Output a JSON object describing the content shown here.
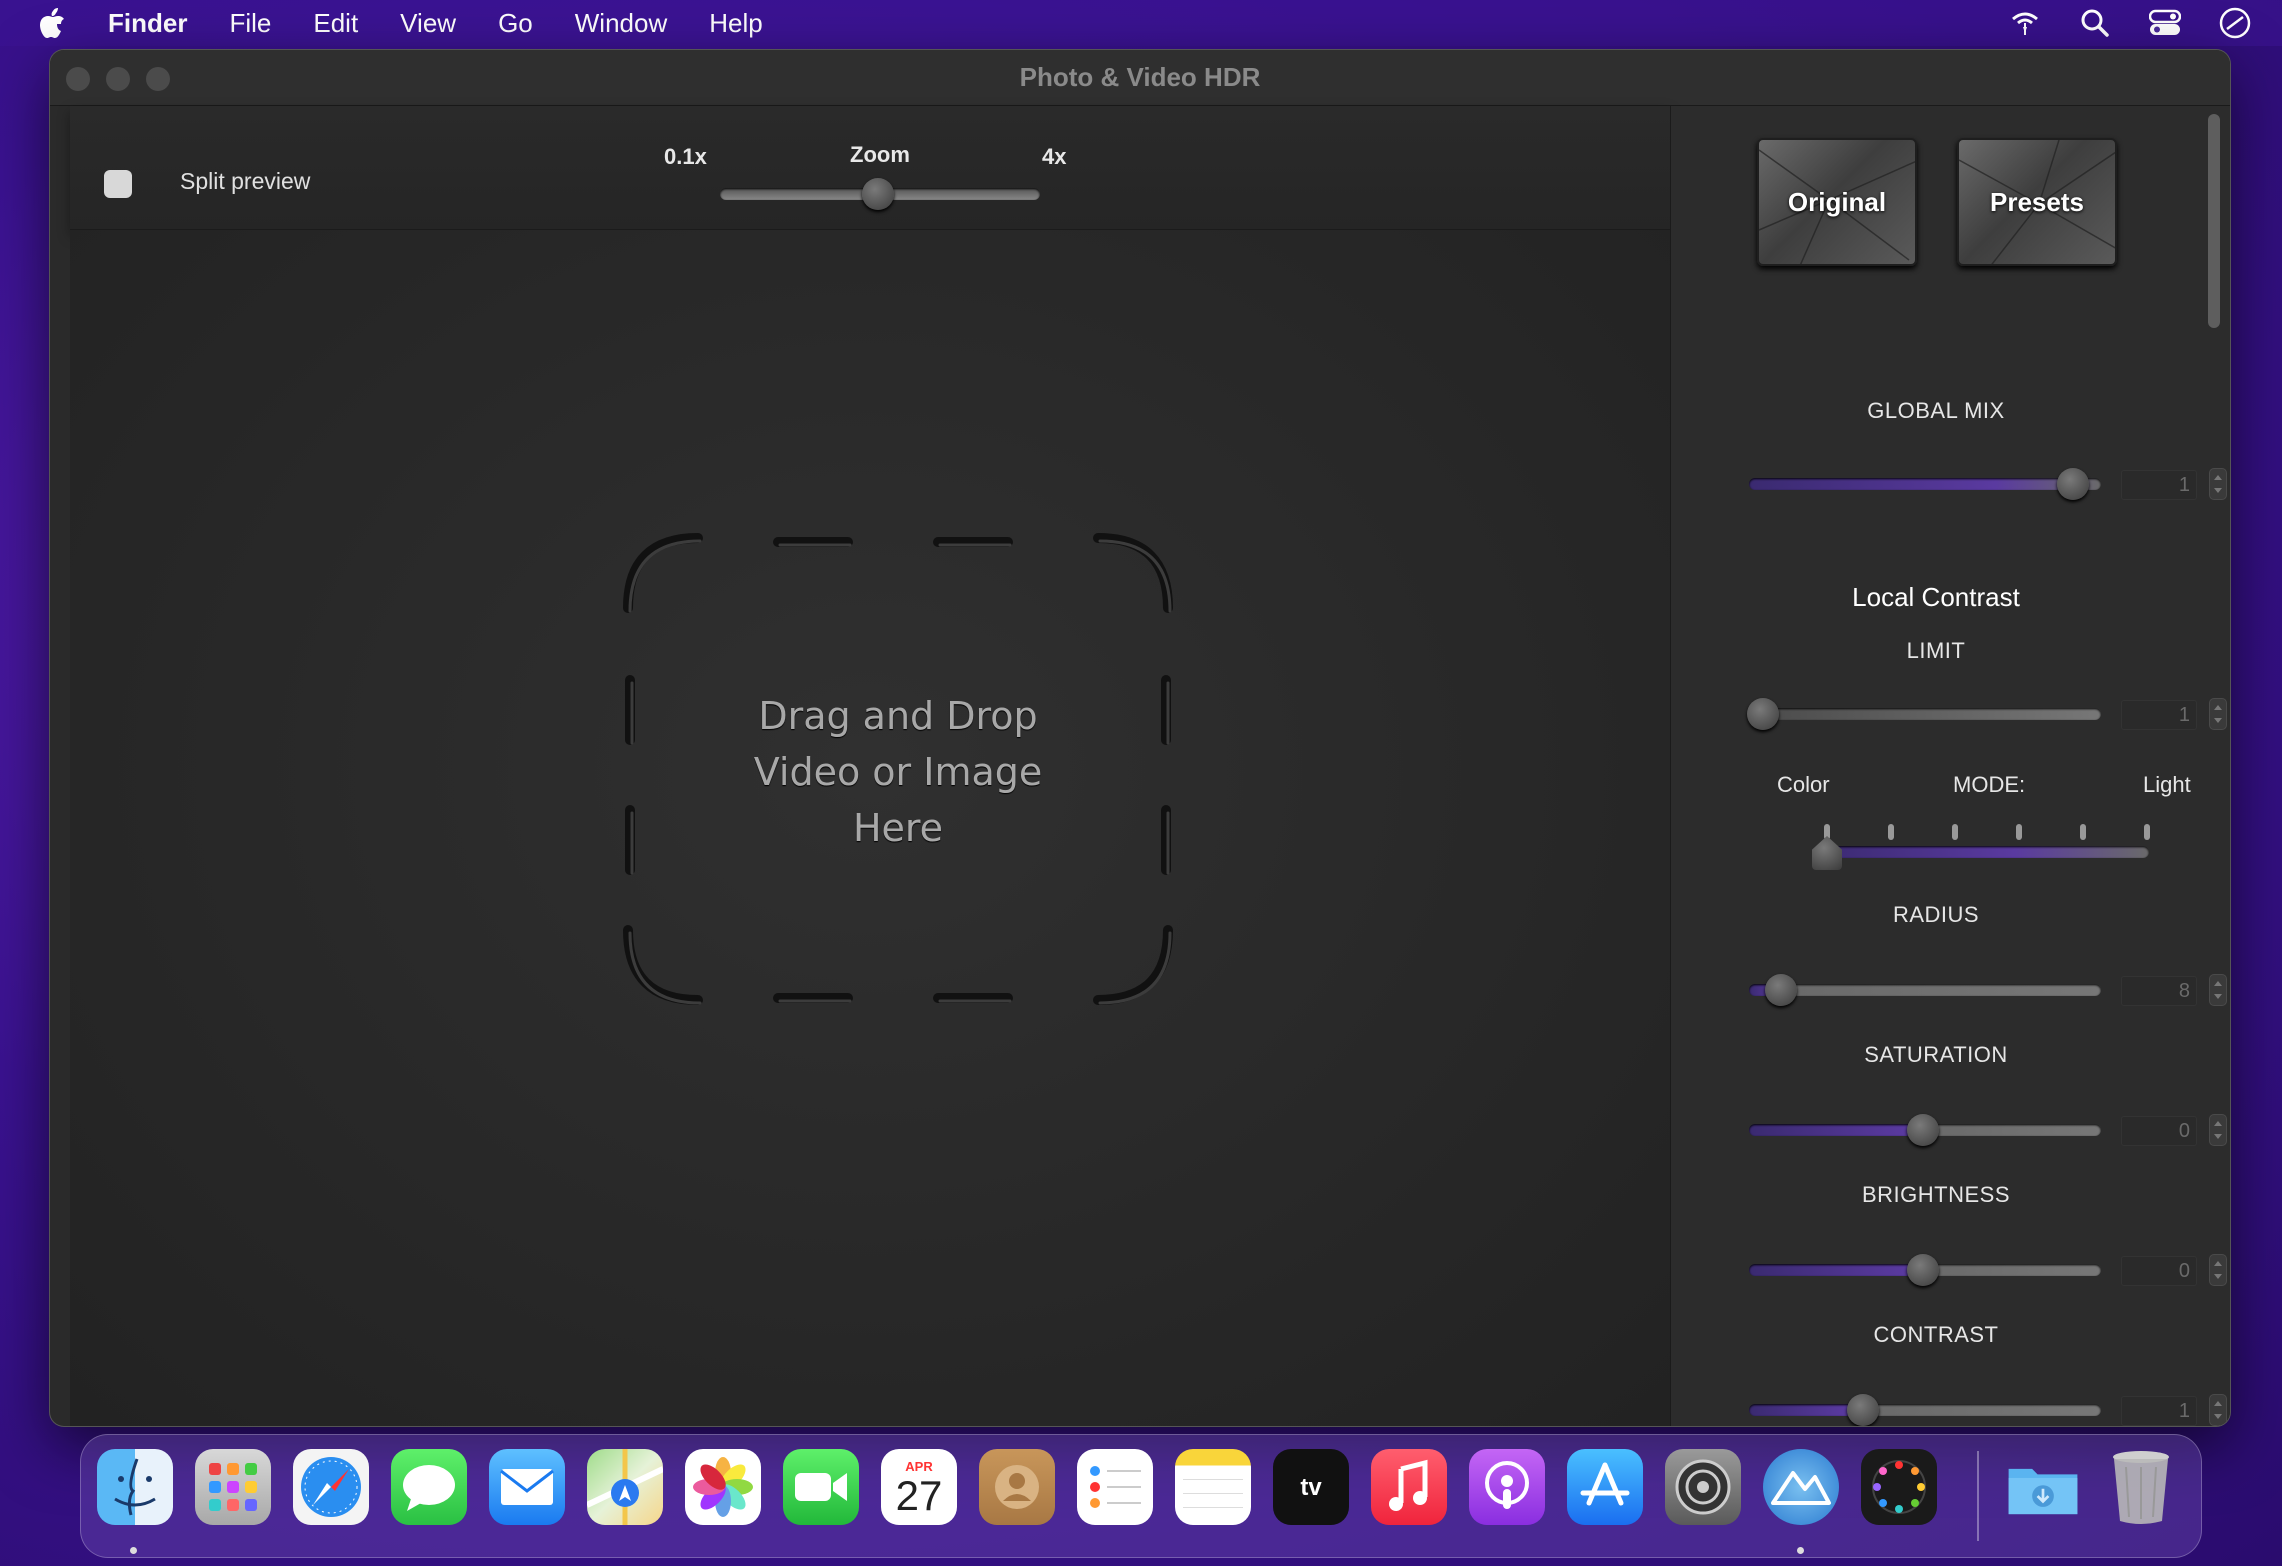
{
  "menubar": {
    "items": [
      "Finder",
      "File",
      "Edit",
      "View",
      "Go",
      "Window",
      "Help"
    ]
  },
  "window": {
    "title": "Photo & Video HDR"
  },
  "toolbar": {
    "split_preview_label": "Split preview",
    "split_preview_checked": false,
    "zoom_label": "Zoom",
    "zoom_min_label": "0.1x",
    "zoom_max_label": "4x"
  },
  "drop_zone": {
    "line1": "Drag and Drop",
    "line2": "Video or Image",
    "line3": "Here"
  },
  "panel": {
    "original_button": "Original",
    "presets_button": "Presets",
    "global_mix": {
      "label": "GLOBAL MIX",
      "value": "1"
    },
    "local_contrast_title": "Local Contrast",
    "limit": {
      "label": "LIMIT",
      "value": "1"
    },
    "mode": {
      "label": "MODE:",
      "left_label": "Color",
      "right_label": "Light",
      "steps": 6,
      "selected_index": 0
    },
    "radius": {
      "label": "RADIUS",
      "value": "8"
    },
    "saturation": {
      "label": "SATURATION",
      "value": "0"
    },
    "brightness": {
      "label": "BRIGHTNESS",
      "value": "0"
    },
    "contrast": {
      "label": "CONTRAST",
      "value": "1"
    }
  },
  "dock": {
    "calendar_month": "APR",
    "calendar_day": "27",
    "apps": [
      "finder-icon",
      "launchpad-icon",
      "safari-icon",
      "messages-icon",
      "mail-icon",
      "maps-icon",
      "photos-icon",
      "facetime-icon",
      "calendar-icon",
      "contacts-icon",
      "reminders-icon",
      "notes-icon",
      "appletv-icon",
      "music-icon",
      "podcasts-icon",
      "appstore-icon",
      "system-settings-icon",
      "photo-video-hdr-icon",
      "color-app-icon",
      "downloads-folder-icon",
      "trash-icon"
    ]
  },
  "colors": {
    "accent_purple": "#5a3aa0",
    "desktop_purple": "#3a1290",
    "window_bg": "#2a2a2a"
  }
}
